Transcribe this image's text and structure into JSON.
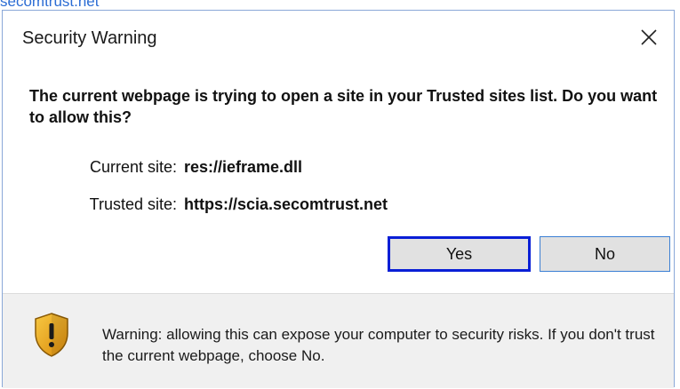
{
  "backdrop": {
    "partial_text": "secomtrust.net"
  },
  "dialog": {
    "title": "Security Warning",
    "question": "The current webpage is trying to open a site in your Trusted sites list. Do you want to allow this?",
    "current_site": {
      "label": "Current site:",
      "value": "res://ieframe.dll"
    },
    "trusted_site": {
      "label": "Trusted site:",
      "value": "https://scia.secomtrust.net"
    },
    "buttons": {
      "yes": "Yes",
      "no": "No"
    },
    "warning": "Warning: allowing this can expose your computer to security risks. If you don't trust the current webpage, choose No.",
    "icons": {
      "close": "close-icon",
      "shield": "shield-warning-icon"
    },
    "colors": {
      "focus_border": "#0a1fd6",
      "button_border": "#3b7fd4",
      "shield_gold": "#e8a317"
    }
  }
}
